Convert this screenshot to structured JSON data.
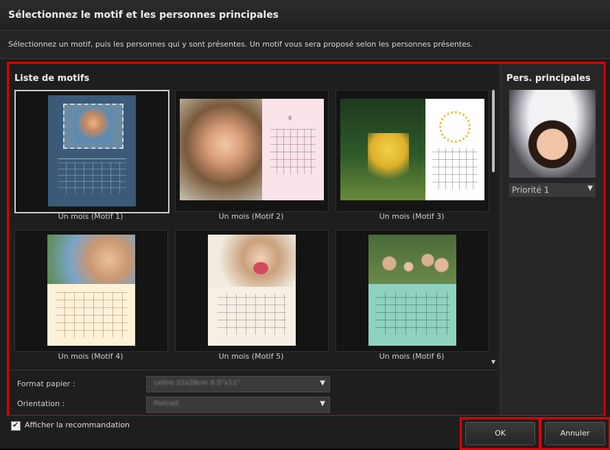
{
  "dialog": {
    "title": "Sélectionnez le motif et les personnes principales",
    "instructions": "Sélectionnez un motif, puis les personnes qui y sont présentes. Un motif vous sera proposé selon les personnes présentes."
  },
  "motifs": {
    "heading": "Liste de motifs",
    "items": [
      {
        "label": "Un mois (Motif 1)",
        "selected": true
      },
      {
        "label": "Un mois (Motif 2)",
        "selected": false
      },
      {
        "label": "Un mois (Motif 3)",
        "selected": false
      },
      {
        "label": "Un mois (Motif 4)",
        "selected": false
      },
      {
        "label": "Un mois (Motif 5)",
        "selected": false
      },
      {
        "label": "Un mois (Motif 6)",
        "selected": false
      }
    ],
    "calendar_month": "9"
  },
  "settings": {
    "paper_label": "Format papier :",
    "paper_value": "Lettre 22x28cm 8.5\"x11\"",
    "orientation_label": "Orientation :",
    "orientation_value": "Portrait"
  },
  "people": {
    "heading": "Pers. principales",
    "priority_value": "Priorité 1"
  },
  "footer": {
    "recommend_label": "Afficher la recommandation",
    "recommend_checked": true,
    "ok_label": "OK",
    "cancel_label": "Annuler"
  },
  "colors": {
    "highlight": "#e00000",
    "background": "#1c1c1c"
  }
}
